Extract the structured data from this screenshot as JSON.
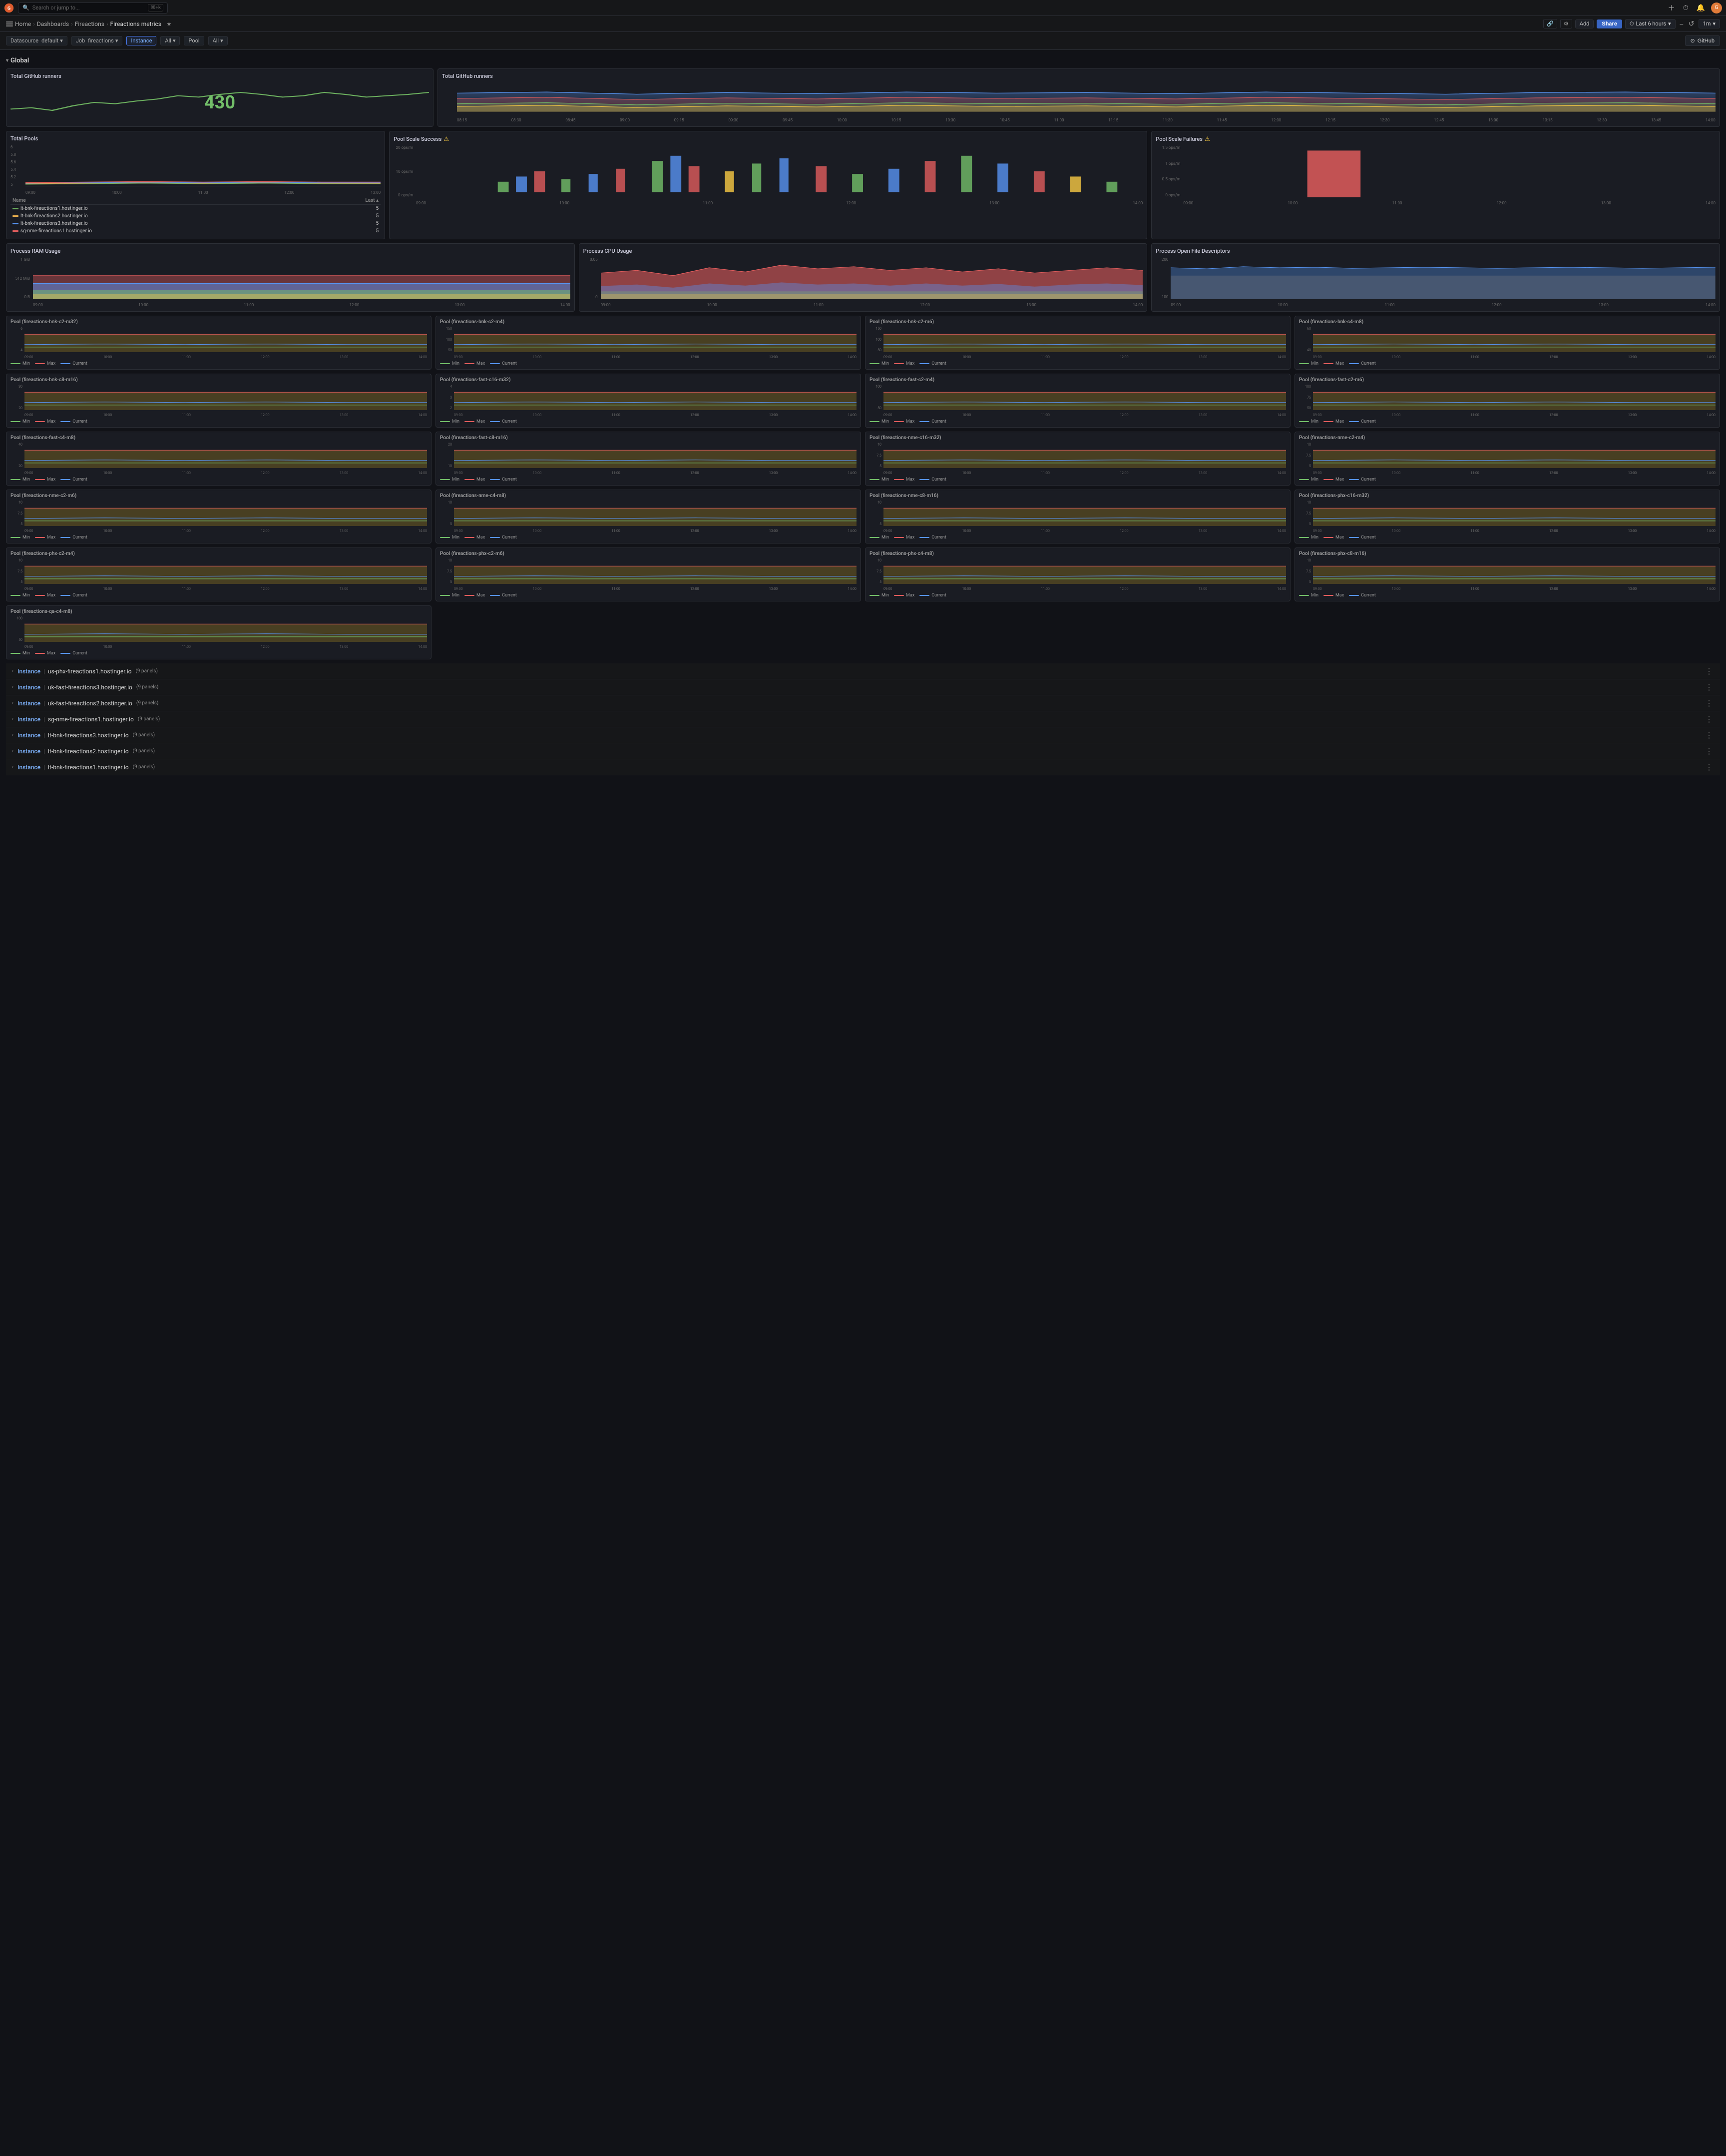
{
  "app": {
    "title": "Grafana",
    "logo_text": "G"
  },
  "topbar": {
    "search_placeholder": "Search or jump to...",
    "shortcut": "⌘+k",
    "icons": [
      "plus",
      "clock",
      "bell",
      "avatar"
    ]
  },
  "breadcrumb": {
    "home": "Home",
    "dashboards": "Dashboards",
    "fireactions": "Fireactions",
    "current": "Fireactions metrics",
    "star_icon": "★"
  },
  "toolbar": {
    "add_label": "Add",
    "share_label": "Share",
    "time_range_label": "Last 6 hours",
    "zoom_in": "+",
    "zoom_out": "−",
    "refresh": "↺",
    "interval": "1m"
  },
  "filters": {
    "datasource_label": "Datasource",
    "datasource_value": "default",
    "job_label": "Job",
    "job_value": "fireactions",
    "instance_label": "Instance",
    "pool_label": "Pool",
    "all_label": "All",
    "github_btn": "GitHub"
  },
  "global_section": {
    "title": "Global",
    "total_runners_title": "Total GitHub runners",
    "total_runners_value": "430",
    "total_runners_chart_title": "Total GitHub runners",
    "total_pools_title": "Total Pools",
    "pool_scale_success_title": "Pool Scale Success",
    "pool_scale_failures_title": "Pool Scale Failures",
    "process_ram_title": "Process RAM Usage",
    "process_cpu_title": "Process CPU Usage",
    "process_fd_title": "Process Open File Descriptors"
  },
  "x_axis_times": [
    "08:15",
    "08:30",
    "08:45",
    "09:00",
    "09:15",
    "09:30",
    "09:45",
    "10:00",
    "10:15",
    "10:30",
    "10:45",
    "11:00",
    "11:15",
    "11:30",
    "11:45",
    "12:00",
    "12:15",
    "12:30",
    "12:45",
    "13:00",
    "13:15",
    "13:30",
    "13:45",
    "14:00"
  ],
  "x_short": [
    "09:00",
    "10:00",
    "11:00",
    "12:00",
    "13:00",
    "14:00"
  ],
  "pool_table": {
    "col_name": "Name",
    "col_last": "Last ▴",
    "rows": [
      {
        "color": "#6bae5e",
        "name": "lt-bnk-fireactions1.hostinger.io",
        "value": "5"
      },
      {
        "color": "#e5ac4d",
        "name": "lt-bnk-fireactions2.hostinger.io",
        "value": "5"
      },
      {
        "color": "#5794f2",
        "name": "lt-bnk-fireactions3.hostinger.io",
        "value": "5"
      },
      {
        "color": "#e05c5c",
        "name": "sg-nme-fireactions1.hostinger.io",
        "value": "5"
      }
    ]
  },
  "pools_y": [
    "6",
    "5.8",
    "5.6",
    "5.4",
    "5.2",
    "5"
  ],
  "process_ram_y": [
    "1 GiB",
    "512 MiB",
    "0 B"
  ],
  "process_cpu_y": [
    "0.05",
    "0"
  ],
  "process_fd_y": [
    "200",
    "100"
  ],
  "pools": [
    {
      "name": "Pool (fireactions-bnk-c2-m32)",
      "y": [
        "6",
        "4"
      ]
    },
    {
      "name": "Pool (fireactions-bnk-c2-m4)",
      "y": [
        "150",
        "100",
        "50"
      ]
    },
    {
      "name": "Pool (fireactions-bnk-c2-m6)",
      "y": [
        "150",
        "100",
        "50"
      ]
    },
    {
      "name": "Pool (fireactions-bnk-c4-m8)",
      "y": [
        "60",
        "40"
      ]
    },
    {
      "name": "Pool (fireactions-bnk-c8-m16)",
      "y": [
        "30",
        "20"
      ]
    },
    {
      "name": "Pool (fireactions-fast-c16-m32)",
      "y": [
        "4",
        "3",
        "2"
      ]
    },
    {
      "name": "Pool (fireactions-fast-c2-m4)",
      "y": [
        "100",
        "50"
      ]
    },
    {
      "name": "Pool (fireactions-fast-c2-m6)",
      "y": [
        "100",
        "75",
        "50"
      ]
    },
    {
      "name": "Pool (fireactions-fast-c4-m8)",
      "y": [
        "40",
        "20"
      ]
    },
    {
      "name": "Pool (fireactions-fast-c8-m16)",
      "y": [
        "20",
        "10"
      ]
    },
    {
      "name": "Pool (fireactions-nme-c16-m32)",
      "y": [
        "10",
        "7.5",
        "5"
      ]
    },
    {
      "name": "Pool (fireactions-nme-c2-m4)",
      "y": [
        "10",
        "7.5",
        "5"
      ]
    },
    {
      "name": "Pool (fireactions-nme-c2-m6)",
      "y": [
        "10",
        "7.5",
        "5"
      ]
    },
    {
      "name": "Pool (fireactions-nme-c4-m8)",
      "y": [
        "10",
        "5"
      ]
    },
    {
      "name": "Pool (fireactions-nme-c8-m16)",
      "y": [
        "10",
        "5"
      ]
    },
    {
      "name": "Pool (fireactions-phx-c16-m32)",
      "y": [
        "10",
        "7.5",
        "5"
      ]
    },
    {
      "name": "Pool (fireactions-phx-c2-m4)",
      "y": [
        "10",
        "7.5",
        "5"
      ]
    },
    {
      "name": "Pool (fireactions-phx-c2-m6)",
      "y": [
        "10",
        "7.5",
        "5"
      ]
    },
    {
      "name": "Pool (fireactions-phx-c4-m8)",
      "y": [
        "10",
        "7.5",
        "5"
      ]
    },
    {
      "name": "Pool (fireactions-phx-c8-m16)",
      "y": [
        "10",
        "7.5",
        "5"
      ]
    },
    {
      "name": "Pool (fireactions-qa-c4-m8)",
      "y": [
        "100",
        "50"
      ]
    }
  ],
  "pool_legend": {
    "min": "Min",
    "max": "Max",
    "current": "Current",
    "min_color": "#73bf69",
    "max_color": "#e05c5c",
    "current_color": "#5794f2"
  },
  "instances": [
    {
      "label": "Instance",
      "sep": "|",
      "name": "us-phx-fireactions1.hostinger.io",
      "count": "9 panels"
    },
    {
      "label": "Instance",
      "sep": "|",
      "name": "uk-fast-fireactions3.hostinger.io",
      "count": "9 panels"
    },
    {
      "label": "Instance",
      "sep": "|",
      "name": "uk-fast-fireactions2.hostinger.io",
      "count": "9 panels"
    },
    {
      "label": "Instance",
      "sep": "|",
      "name": "sg-nme-fireactions1.hostinger.io",
      "count": "9 panels"
    },
    {
      "label": "Instance",
      "sep": "|",
      "name": "lt-bnk-fireactions3.hostinger.io",
      "count": "9 panels"
    },
    {
      "label": "Instance",
      "sep": "|",
      "name": "lt-bnk-fireactions2.hostinger.io",
      "count": "9 panels"
    },
    {
      "label": "Instance",
      "sep": "|",
      "name": "lt-bnk-fireactions1.hostinger.io",
      "count": "9 panels"
    }
  ]
}
